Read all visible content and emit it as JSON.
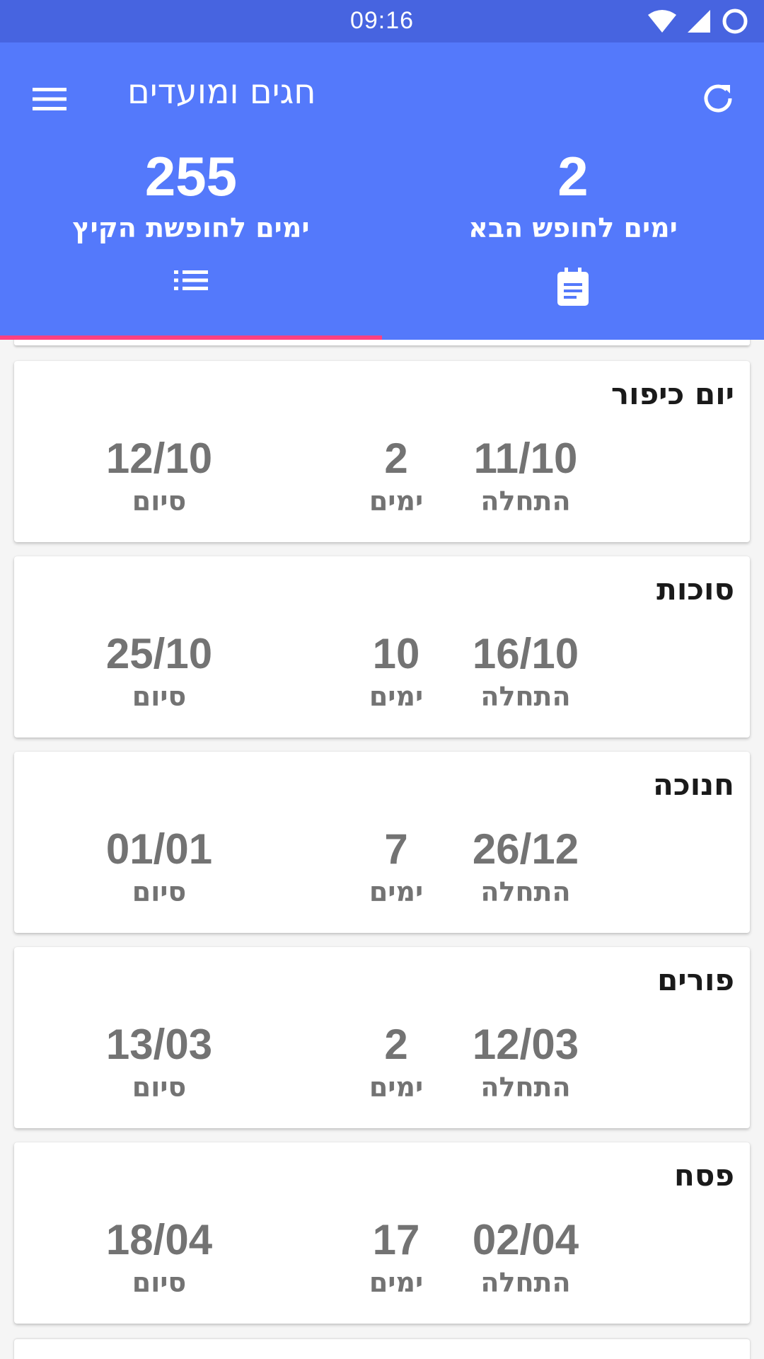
{
  "status_bar": {
    "time": "09:16",
    "icons": [
      "wifi-icon",
      "cell-signal-icon",
      "battery-icon"
    ]
  },
  "app_bar": {
    "title": "חגים ומועדים",
    "menu_icon": "hamburger-menu-icon",
    "refresh_icon": "refresh-icon",
    "background_color": "#5479fb",
    "status_color": "#4764e0"
  },
  "counters": {
    "summer": {
      "number": "255",
      "label": "ימים לחופשת הקיץ"
    },
    "next_holiday": {
      "number": "2",
      "label": "ימים לחופש הבא"
    }
  },
  "tabs": [
    {
      "icon": "list-icon",
      "selected": true
    },
    {
      "icon": "calendar-note-icon",
      "selected": false
    }
  ],
  "accent_color": "#ff4081",
  "holidays": [
    {
      "name": "יום כיפור",
      "start": "11/10",
      "days": "2",
      "end": "12/10",
      "start_label": "התחלה",
      "days_label": "ימים",
      "end_label": "סיום"
    },
    {
      "name": "סוכות",
      "start": "16/10",
      "days": "10",
      "end": "25/10",
      "start_label": "התחלה",
      "days_label": "ימים",
      "end_label": "סיום"
    },
    {
      "name": "חנוכה",
      "start": "26/12",
      "days": "7",
      "end": "01/01",
      "start_label": "התחלה",
      "days_label": "ימים",
      "end_label": "סיום"
    },
    {
      "name": "פורים",
      "start": "12/03",
      "days": "2",
      "end": "13/03",
      "start_label": "התחלה",
      "days_label": "ימים",
      "end_label": "סיום"
    },
    {
      "name": "פסח",
      "start": "02/04",
      "days": "17",
      "end": "18/04",
      "start_label": "התחלה",
      "days_label": "ימים",
      "end_label": "סיום"
    }
  ]
}
